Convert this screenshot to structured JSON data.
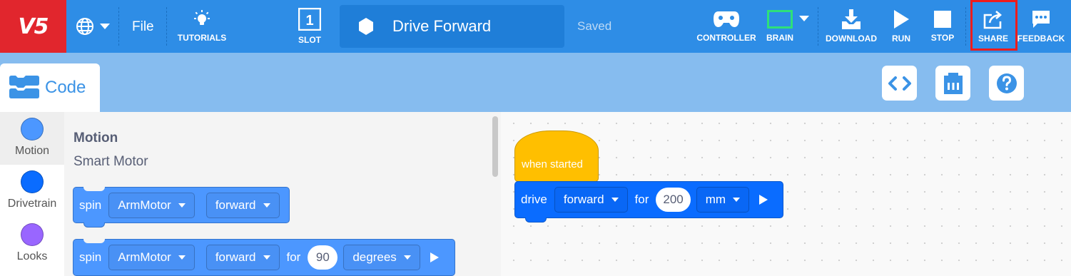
{
  "toolbar": {
    "logo_text": "V5",
    "menu_file": "File",
    "tutorials": "TUTORIALS",
    "slot": "SLOT",
    "slot_number": "1",
    "project_title": "Drive Forward",
    "status": "Saved",
    "controller": "CONTROLLER",
    "brain": "BRAIN",
    "download": "DOWNLOAD",
    "run": "RUN",
    "stop": "STOP",
    "share": "SHARE",
    "feedback": "FEEDBACK",
    "highlight_color": "#ee1c1c",
    "brand_color": "#e1262d",
    "bar_color": "#2e8de6"
  },
  "tabs": {
    "code": "Code"
  },
  "categories": [
    {
      "label": "Motion",
      "color": "#4c97ff",
      "icon": "motion-dot"
    },
    {
      "label": "Drivetrain",
      "color": "#0a6cff",
      "icon": "drivetrain-dot"
    },
    {
      "label": "Looks",
      "color": "#9966ff",
      "icon": "looks-dot"
    }
  ],
  "flyout": {
    "heading": "Motion",
    "subheading": "Smart Motor",
    "block1": {
      "verb": "spin",
      "motor": "ArmMotor",
      "direction": "forward"
    },
    "block2": {
      "verb": "spin",
      "motor": "ArmMotor",
      "direction": "forward",
      "for": "for",
      "amount": "90",
      "unit": "degrees"
    }
  },
  "workspace": {
    "hat": "when started",
    "drive": {
      "verb": "drive",
      "direction": "forward",
      "for": "for",
      "amount": "200",
      "unit": "mm"
    }
  }
}
